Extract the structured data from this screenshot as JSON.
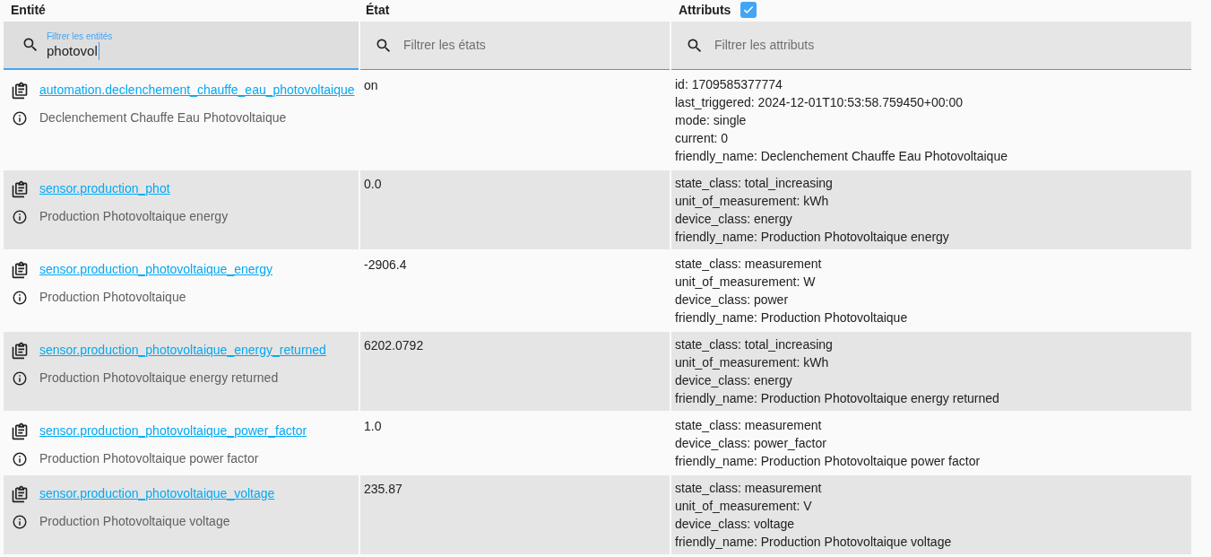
{
  "headers": {
    "entity": "Entité",
    "state": "État",
    "attributes": "Attributs",
    "attributes_checked": true
  },
  "filters": {
    "entity": {
      "label": "Filtrer les entités",
      "value": "photovol"
    },
    "state": {
      "placeholder": "Filtrer les états"
    },
    "attributes": {
      "placeholder": "Filtrer les attributs"
    }
  },
  "rows": [
    {
      "entity_id": "automation.declenchement_chauffe_eau_photovoltaique",
      "name": "Declenchement Chauffe Eau Photovoltaique",
      "state": "on",
      "attributes": [
        "id: 1709585377774",
        "last_triggered: 2024-12-01T10:53:58.759450+00:00",
        "mode: single",
        "current: 0",
        "friendly_name: Declenchement Chauffe Eau Photovoltaique"
      ]
    },
    {
      "entity_id": "sensor.production_phot",
      "name": "Production Photovoltaique energy",
      "state": "0.0",
      "attributes": [
        "state_class: total_increasing",
        "unit_of_measurement: kWh",
        "device_class: energy",
        "friendly_name: Production Photovoltaique energy"
      ]
    },
    {
      "entity_id": "sensor.production_photovoltaique_energy",
      "name": "Production Photovoltaique",
      "state": "-2906.4",
      "attributes": [
        "state_class: measurement",
        "unit_of_measurement: W",
        "device_class: power",
        "friendly_name: Production Photovoltaique"
      ]
    },
    {
      "entity_id": "sensor.production_photovoltaique_energy_returned",
      "name": "Production Photovoltaique energy returned",
      "state": "6202.0792",
      "attributes": [
        "state_class: total_increasing",
        "unit_of_measurement: kWh",
        "device_class: energy",
        "friendly_name: Production Photovoltaique energy returned"
      ]
    },
    {
      "entity_id": "sensor.production_photovoltaique_power_factor",
      "name": "Production Photovoltaique power factor",
      "state": "1.0",
      "attributes": [
        "state_class: measurement",
        "device_class: power_factor",
        "friendly_name: Production Photovoltaique power factor"
      ]
    },
    {
      "entity_id": "sensor.production_photovoltaique_voltage",
      "name": "Production Photovoltaique voltage",
      "state": "235.87",
      "attributes": [
        "state_class: measurement",
        "unit_of_measurement: V",
        "device_class: voltage",
        "friendly_name: Production Photovoltaique voltage"
      ]
    }
  ]
}
